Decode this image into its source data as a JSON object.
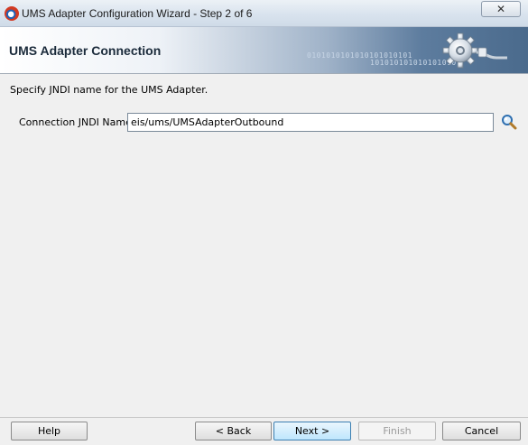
{
  "window": {
    "title": "UMS Adapter Configuration Wizard - Step 2 of 6",
    "close_glyph": "✕"
  },
  "banner": {
    "title": "UMS Adapter Connection",
    "binary_line1": "0101010101010101010101",
    "binary_line2": "1010101010101010101"
  },
  "main": {
    "instruction": "Specify JNDI name for the UMS Adapter.",
    "jndi_label": "Connection JNDI Name:",
    "jndi_value": "eis/ums/UMSAdapterOutbound"
  },
  "buttons": {
    "help": "Help",
    "back": "< Back",
    "next": "Next >",
    "finish": "Finish",
    "cancel": "Cancel"
  },
  "icons": {
    "app": "oracle-app-icon",
    "banner": "gear-plug-icon",
    "search": "magnifier-icon"
  },
  "colors": {
    "banner_dark": "#4a6a8c",
    "accent_button": "#3c7fb1"
  }
}
